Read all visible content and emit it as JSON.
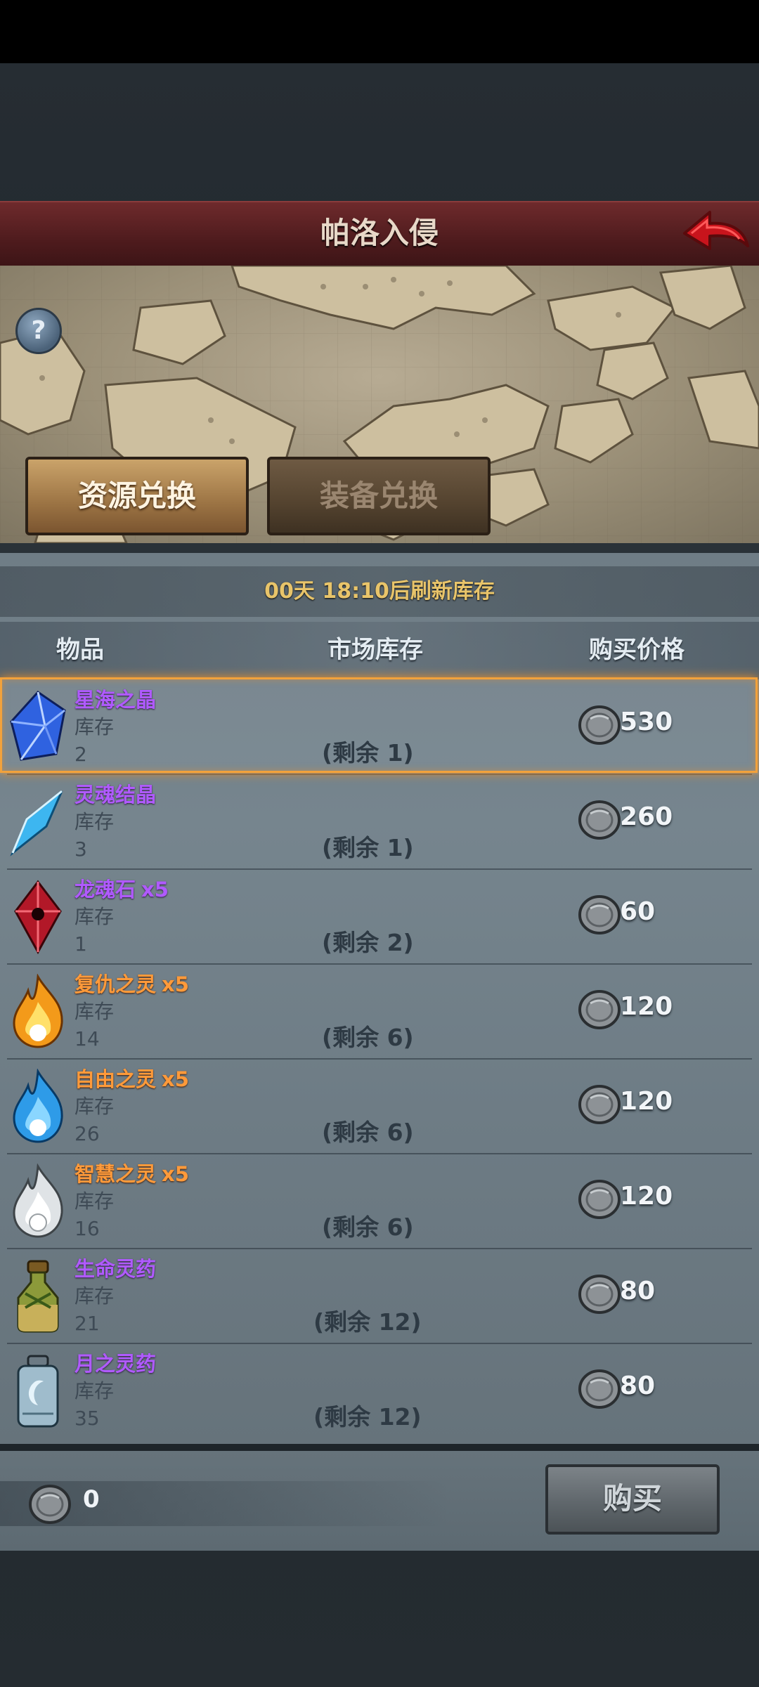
{
  "header": {
    "title": "帕洛入侵"
  },
  "help": {
    "label": "?"
  },
  "tabs": [
    {
      "label": "资源兑换",
      "active": true
    },
    {
      "label": "装备兑换",
      "active": false
    }
  ],
  "refresh_text": "00天 18:10后刷新库存",
  "columns": {
    "item": "物品",
    "market_stock": "市场库存",
    "price": "购买价格"
  },
  "stock_label": "库存",
  "items": [
    {
      "name": "星海之晶",
      "qty": "",
      "name_color": "purple",
      "stock": "2",
      "remain": "(剩余 1)",
      "price": "530",
      "icon": "blue-crystal-icon",
      "selected": true
    },
    {
      "name": "灵魂结晶",
      "qty": "",
      "name_color": "purple",
      "stock": "3",
      "remain": "(剩余 1)",
      "price": "260",
      "icon": "soul-crystal-icon",
      "selected": false
    },
    {
      "name": "龙魂石",
      "qty": "x5",
      "name_color": "purple",
      "stock": "1",
      "remain": "(剩余 2)",
      "price": "60",
      "icon": "dragon-soul-stone-icon",
      "selected": false
    },
    {
      "name": "复仇之灵",
      "qty": "x5",
      "name_color": "orange",
      "stock": "14",
      "remain": "(剩余 6)",
      "price": "120",
      "icon": "orange-flame-icon",
      "selected": false
    },
    {
      "name": "自由之灵",
      "qty": "x5",
      "name_color": "orange",
      "stock": "26",
      "remain": "(剩余 6)",
      "price": "120",
      "icon": "blue-flame-icon",
      "selected": false
    },
    {
      "name": "智慧之灵",
      "qty": "x5",
      "name_color": "orange",
      "stock": "16",
      "remain": "(剩余 6)",
      "price": "120",
      "icon": "white-flame-icon",
      "selected": false
    },
    {
      "name": "生命灵药",
      "qty": "",
      "name_color": "purple",
      "stock": "21",
      "remain": "(剩余 12)",
      "price": "80",
      "icon": "life-potion-icon",
      "selected": false
    },
    {
      "name": "月之灵药",
      "qty": "",
      "name_color": "purple",
      "stock": "35",
      "remain": "(剩余 12)",
      "price": "80",
      "icon": "moon-potion-icon",
      "selected": false
    }
  ],
  "balance": {
    "value": "0",
    "icon": "silver-coin-icon"
  },
  "buy_button": {
    "label": "购买"
  },
  "colors": {
    "purple": "#b05aff",
    "orange": "#ff9a3a",
    "selection": "#f2a23c",
    "gold_text": "#e8c46a"
  }
}
